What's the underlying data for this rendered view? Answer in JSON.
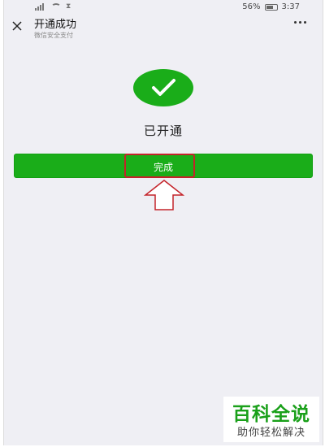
{
  "status_bar": {
    "battery_percent": "56%",
    "time": "3:37"
  },
  "header": {
    "title": "开通成功",
    "subtitle": "微信安全支付",
    "close_icon": "close-icon",
    "more_icon": "more-icon"
  },
  "result": {
    "icon": "checkmark-icon",
    "status_text": "已开通",
    "done_label": "完成"
  },
  "annotation": {
    "highlight_color": "#c4232a",
    "arrow_icon": "up-arrow-icon"
  },
  "watermark": {
    "brand": "百科全说",
    "tagline": "助你轻松解决"
  },
  "colors": {
    "accent": "#1aad19",
    "background": "#efeff4"
  }
}
